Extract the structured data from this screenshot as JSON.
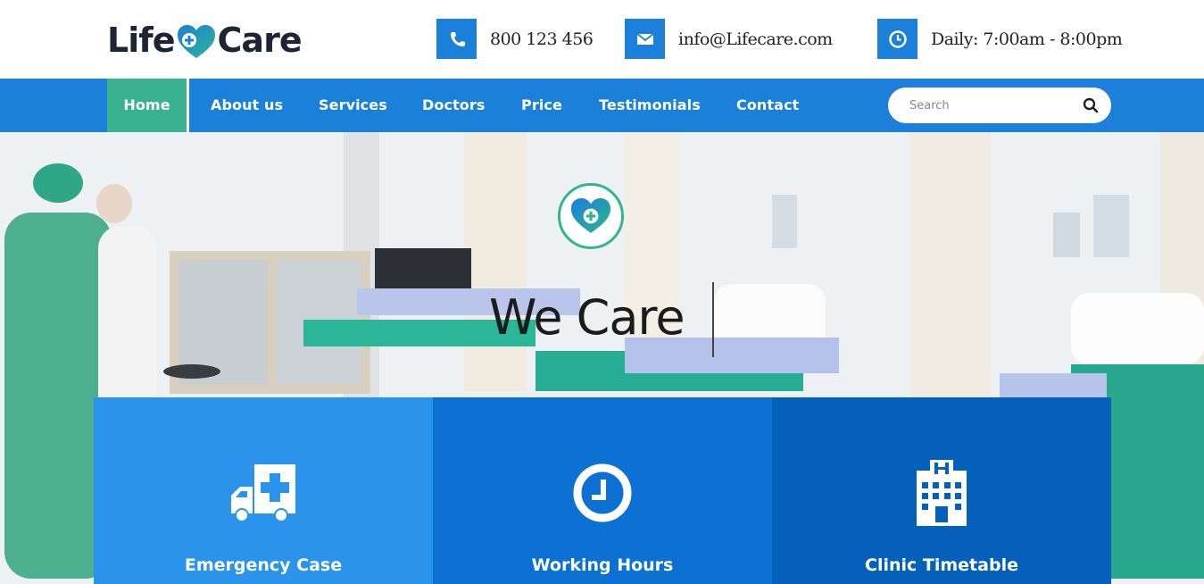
{
  "brand": {
    "name_left": "Life",
    "name_right": "Care"
  },
  "colors": {
    "primary": "#1a80d9",
    "accent": "#3bb28f",
    "box1": "#2a93ec",
    "box2": "#0d71d4",
    "box3": "#0560bb"
  },
  "contacts": [
    {
      "icon": "phone-icon",
      "text": "800 123 456"
    },
    {
      "icon": "envelope-icon",
      "text": "info@Lifecare.com"
    },
    {
      "icon": "clock-icon",
      "text": "Daily: 7:00am - 8:00pm"
    }
  ],
  "nav": {
    "items": [
      "Home",
      "About us",
      "Services",
      "Doctors",
      "Price",
      "Testimonials",
      "Contact"
    ],
    "active": "Home"
  },
  "search": {
    "placeholder": "Search"
  },
  "hero": {
    "title": "We Care"
  },
  "features": [
    {
      "icon": "ambulance-icon",
      "title": "Emergency Case"
    },
    {
      "icon": "clock-icon",
      "title": "Working Hours"
    },
    {
      "icon": "hospital-building-icon",
      "title": "Clinic Timetable"
    }
  ]
}
